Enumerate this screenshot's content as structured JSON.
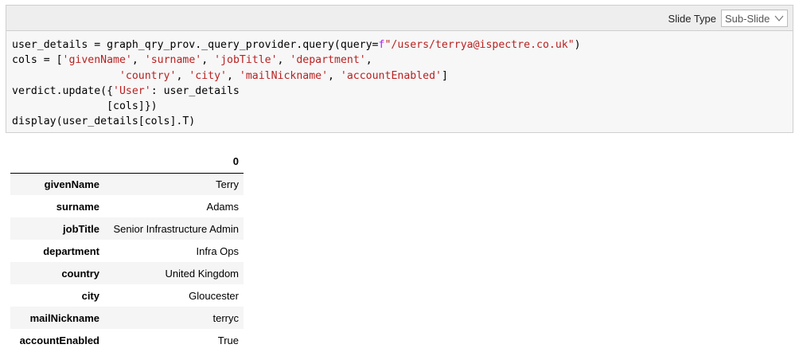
{
  "toolbar": {
    "slide_type_label": "Slide Type",
    "slide_type_value": "Sub-Slide",
    "chevron_icon": "chevron-down-icon"
  },
  "code": {
    "line1_a": "user_details = graph_qry_prov._query_provider.query(query=",
    "line1_f": "f",
    "line1_str": "\"/users/terrya@ispectre.co.uk\"",
    "line1_end": ")",
    "line2_a": "cols = [",
    "line2_s1": "'givenName'",
    "line2_c1": ", ",
    "line2_s2": "'surname'",
    "line2_c2": ", ",
    "line2_s3": "'jobTitle'",
    "line2_c3": ", ",
    "line2_s4": "'department'",
    "line2_end": ",",
    "line3_indent": "                 ",
    "line3_s1": "'country'",
    "line3_c1": ", ",
    "line3_s2": "'city'",
    "line3_c2": ", ",
    "line3_s3": "'mailNickname'",
    "line3_c3": ", ",
    "line3_s4": "'accountEnabled'",
    "line3_end": "]",
    "line4_a": "verdict.update({",
    "line4_s": "'User'",
    "line4_b": ": user_details",
    "line5": "               [cols]})",
    "line6": "display(user_details[cols].T)"
  },
  "output": {
    "column_header": "0",
    "rows": [
      {
        "field": "givenName",
        "value": "Terry"
      },
      {
        "field": "surname",
        "value": "Adams"
      },
      {
        "field": "jobTitle",
        "value": "Senior Infrastructure Admin"
      },
      {
        "field": "department",
        "value": "Infra Ops"
      },
      {
        "field": "country",
        "value": "United Kingdom"
      },
      {
        "field": "city",
        "value": "Gloucester"
      },
      {
        "field": "mailNickname",
        "value": "terryc"
      },
      {
        "field": "accountEnabled",
        "value": "True"
      }
    ]
  }
}
